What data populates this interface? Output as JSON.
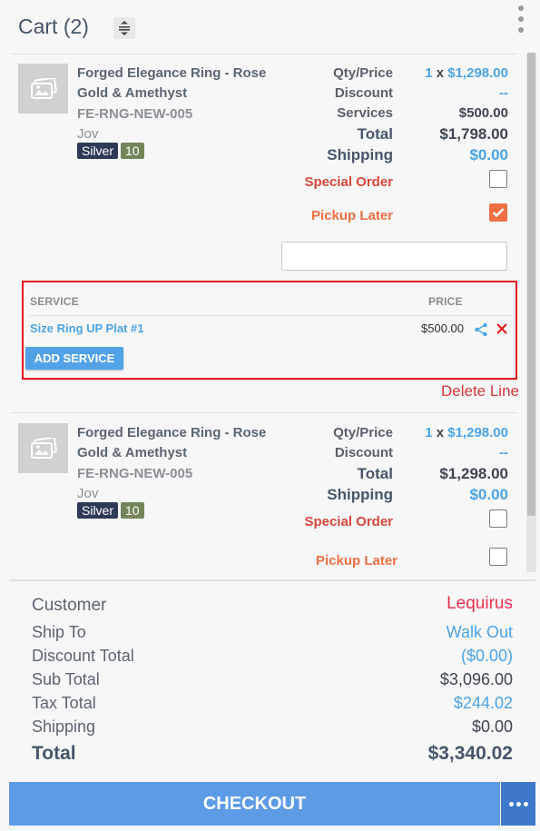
{
  "header": {
    "title": "Cart (2)"
  },
  "items": [
    {
      "name": "Forged Elegance Ring - Rose Gold & Amethyst",
      "sku": "FE-RNG-NEW-005",
      "vendor": "Jov",
      "metal": "Silver",
      "size": "10",
      "qty_price_label": "Qty/Price",
      "qty": "1",
      "qty_sep": " x ",
      "price": "$1,298.00",
      "discount_label": "Discount",
      "discount": "--",
      "services_label": "Services",
      "services": "$500.00",
      "total_label": "Total",
      "total": "$1,798.00",
      "shipping_label": "Shipping",
      "shipping": "$0.00",
      "special_order_label": "Special Order",
      "special_order_checked": false,
      "pickup_later_label": "Pickup Later",
      "pickup_later_checked": true,
      "note_value": ""
    },
    {
      "name": "Forged Elegance Ring - Rose Gold & Amethyst",
      "sku": "FE-RNG-NEW-005",
      "vendor": "Jov",
      "metal": "Silver",
      "size": "10",
      "qty_price_label": "Qty/Price",
      "qty": "1",
      "qty_sep": " x ",
      "price": "$1,298.00",
      "discount_label": "Discount",
      "discount": "--",
      "total_label": "Total",
      "total": "$1,298.00",
      "shipping_label": "Shipping",
      "shipping": "$0.00",
      "special_order_label": "Special Order",
      "special_order_checked": false,
      "pickup_later_label": "Pickup Later",
      "pickup_later_checked": false
    }
  ],
  "service_panel": {
    "col_service": "SERVICE",
    "col_price": "PRICE",
    "rows": [
      {
        "name": "Size Ring UP Plat #1",
        "price": "$500.00"
      }
    ],
    "add_label": "ADD SERVICE",
    "delete_line_label": "Delete Line"
  },
  "summary": {
    "customer_label": "Customer",
    "customer_value": "Lequirus",
    "ship_to_label": "Ship To",
    "ship_to_value": "Walk Out",
    "discount_total_label": "Discount Total",
    "discount_total_value": "($0.00)",
    "sub_total_label": "Sub Total",
    "sub_total_value": "$3,096.00",
    "tax_total_label": "Tax Total",
    "tax_total_value": "$244.02",
    "shipping_label": "Shipping",
    "shipping_value": "$0.00",
    "total_label": "Total",
    "total_value": "$3,340.02"
  },
  "footer": {
    "checkout_label": "CHECKOUT"
  },
  "colors": {
    "accent_blue": "#4aa3e6",
    "checkout_blue": "#5c9be6",
    "danger_red": "#e3141b",
    "pickup_orange": "#ef7043",
    "customer_red": "#e8304f"
  },
  "icons": [
    "collapse-vertical-icon",
    "kebab-menu-icon",
    "image-placeholder-icon",
    "checkmark-icon",
    "share-icon",
    "close-icon",
    "more-horizontal-icon"
  ]
}
